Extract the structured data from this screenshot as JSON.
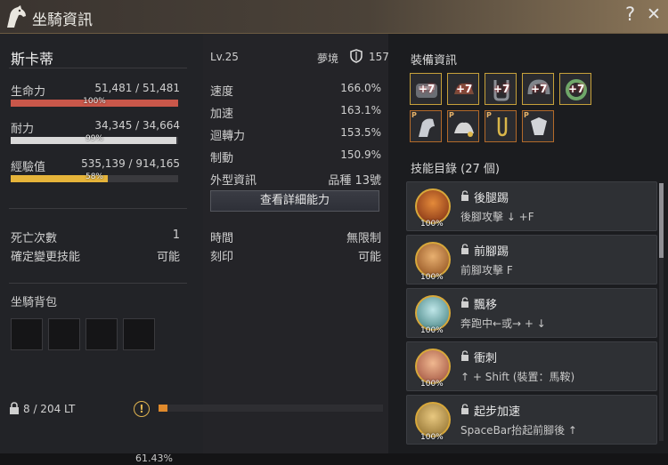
{
  "window": {
    "title": "坐騎資訊",
    "help_label": "?",
    "close_label": "✕"
  },
  "mount": {
    "name": "斯卡蒂",
    "level": "Lv.25",
    "dream_label": "夢境",
    "dream_value": "157"
  },
  "vitals": [
    {
      "label": "生命力",
      "value": "51,481 / 51,481",
      "pct_label": "100%",
      "pct": 1.0,
      "color": "#c9574a"
    },
    {
      "label": "耐力",
      "value": "34,345 / 34,664",
      "pct_label": "99%",
      "pct": 0.99,
      "color": "#d9d9d9"
    },
    {
      "label": "經驗值",
      "value": "535,139 / 914,165",
      "pct_label": "58%",
      "pct": 0.58,
      "color": "#e6b43a"
    }
  ],
  "attributes": [
    {
      "label": "速度",
      "value": "166.0%"
    },
    {
      "label": "加速",
      "value": "163.1%"
    },
    {
      "label": "迴轉力",
      "value": "153.5%"
    },
    {
      "label": "制動",
      "value": "150.9%"
    },
    {
      "label": "外型資訊",
      "value": "品種 13號"
    }
  ],
  "detail_button": "查看詳細能力",
  "info_left": [
    {
      "label": "死亡次數",
      "value": "1"
    },
    {
      "label": "確定變更技能",
      "value": "可能"
    }
  ],
  "info_right": [
    {
      "label": "時間",
      "value": "無限制"
    },
    {
      "label": "刻印",
      "value": "可能"
    }
  ],
  "pack": {
    "title": "坐騎背包",
    "weight": "8 / 204 LT",
    "warn_symbol": "!"
  },
  "equipment": {
    "title": "裝備資訊",
    "top_row": [
      "+7",
      "+7",
      "+7",
      "+7",
      "+7"
    ],
    "bottom_row": [
      "P",
      "P",
      "P",
      "P"
    ]
  },
  "skills": {
    "title": "技能目錄 (27 個)",
    "items": [
      {
        "name": "後腿踢",
        "command": "後腳攻擊 ↓ +F",
        "pct": "100%"
      },
      {
        "name": "前腳踢",
        "command": "前腳攻擊 F",
        "pct": "100%"
      },
      {
        "name": "飄移",
        "command": "奔跑中←或→ + ↓",
        "pct": "100%"
      },
      {
        "name": "衝刺",
        "command": "↑ + Shift (裝置：馬鞍)",
        "pct": "100%"
      },
      {
        "name": "起步加速",
        "command": "SpaceBar抬起前腳後 ↑",
        "pct": "100%"
      }
    ]
  },
  "colors": {
    "accent": "#c7a13a",
    "hp": "#c9574a",
    "exp": "#e6b43a",
    "weight": "#e08a2c"
  },
  "bottom": {
    "text": "61.43%"
  }
}
